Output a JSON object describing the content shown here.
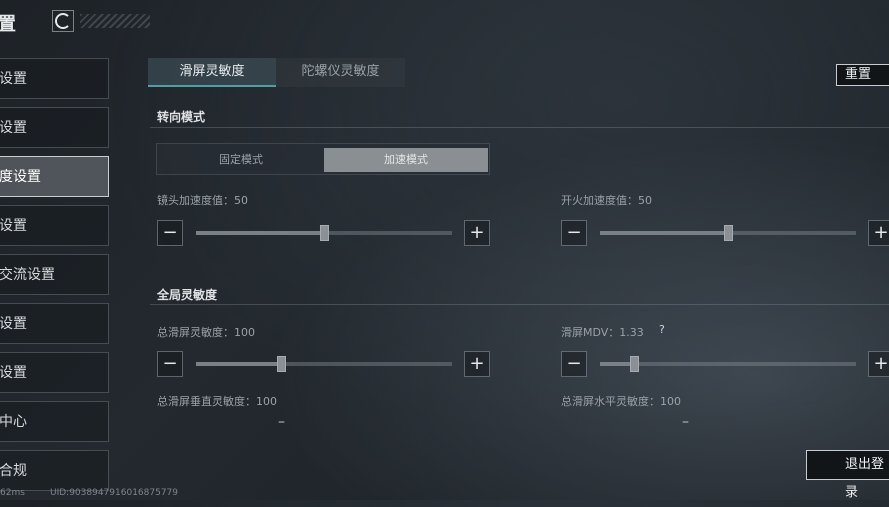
{
  "header": {
    "title": "置",
    "logo_icon": "game-logo-icon"
  },
  "sidebar": {
    "items": [
      {
        "label": "设置"
      },
      {
        "label": "设置"
      },
      {
        "label": "度设置"
      },
      {
        "label": "设置"
      },
      {
        "label": "交流设置"
      },
      {
        "label": "设置"
      },
      {
        "label": "设置"
      },
      {
        "label": "中心"
      },
      {
        "label": "合规"
      }
    ]
  },
  "footer": {
    "ping": "62ms",
    "uid": "UID:90389479160168757​79"
  },
  "tabs": [
    {
      "label": "滑屏灵敏度"
    },
    {
      "label": "陀螺仪灵敏度"
    }
  ],
  "reset_label": "重置",
  "turn_mode": {
    "title": "转向模式",
    "options": [
      {
        "label": "固定模式"
      },
      {
        "label": "加速模式"
      }
    ],
    "selected": "加速模式"
  },
  "sliders": {
    "lens_accel": {
      "label": "镜头加速度值：50",
      "value": 50,
      "max": 100
    },
    "fire_accel": {
      "label": "开火加速度值：50",
      "value": 50,
      "max": 100
    },
    "total_swipe": {
      "label": "总滑屏灵敏度：100",
      "value": 100,
      "max": 300
    },
    "mdv": {
      "label": "滑屏MDV：1.33",
      "value": 1.33,
      "max": 10
    }
  },
  "global_title": "全局灵敏度",
  "help_mark": "?",
  "vertical_label": "总滑屏垂直灵敏度：100",
  "horizontal_label": "总滑屏水平灵敏度：100",
  "minus_symbol": "−",
  "plus_symbol": "+",
  "dash": "–",
  "logout_label": "退出登录"
}
